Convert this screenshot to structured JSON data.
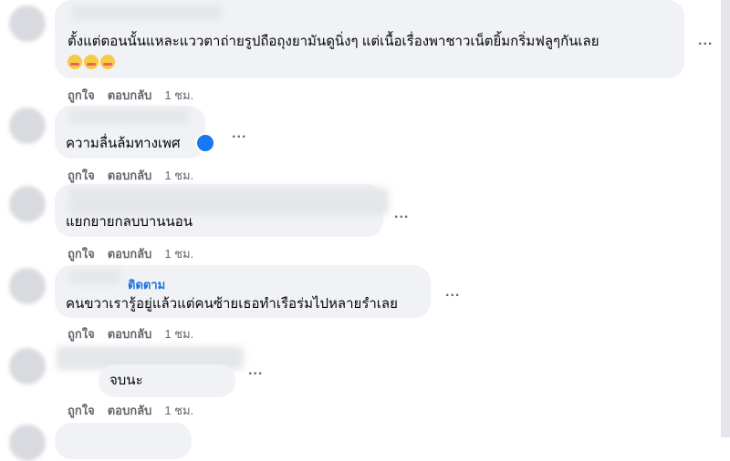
{
  "comments": [
    {
      "text_line1": "ตั้งแต่ตอนนั้นแหละแววตาถ่ายรูปถือถุงยามันดูนิ่งๆ แต่เนื้อเรื่องพาชาวเน็ตยิ้มกริ่มฟลูๆกันเลย",
      "emoji": "smiling-face-with-hands-icon",
      "like": "ถูกใจ",
      "reply": "ตอบกลับ",
      "time": "1 ชม."
    },
    {
      "text": "ความลื่นล้มทางเพศ",
      "like": "ถูกใจ",
      "reply": "ตอบกลับ",
      "time": "1 ชม."
    },
    {
      "text": "แยกยายกลบบานนอน",
      "like": "ถูกใจ",
      "reply": "ตอบกลับ",
      "time": "1 ชม."
    },
    {
      "follow": "ติดตาม",
      "text": "คนขวาเรารู้อยู่แล้วแต่คนซ้ายเธอทำเรือร่มไปหลายรำเลย",
      "like": "ถูกใจ",
      "reply": "ตอบกลับ",
      "time": "1 ชม."
    },
    {
      "text": "จบนะ",
      "like": "ถูกใจ",
      "reply": "ตอบกลับ",
      "time": "1 ชม."
    }
  ],
  "more_label": "..."
}
